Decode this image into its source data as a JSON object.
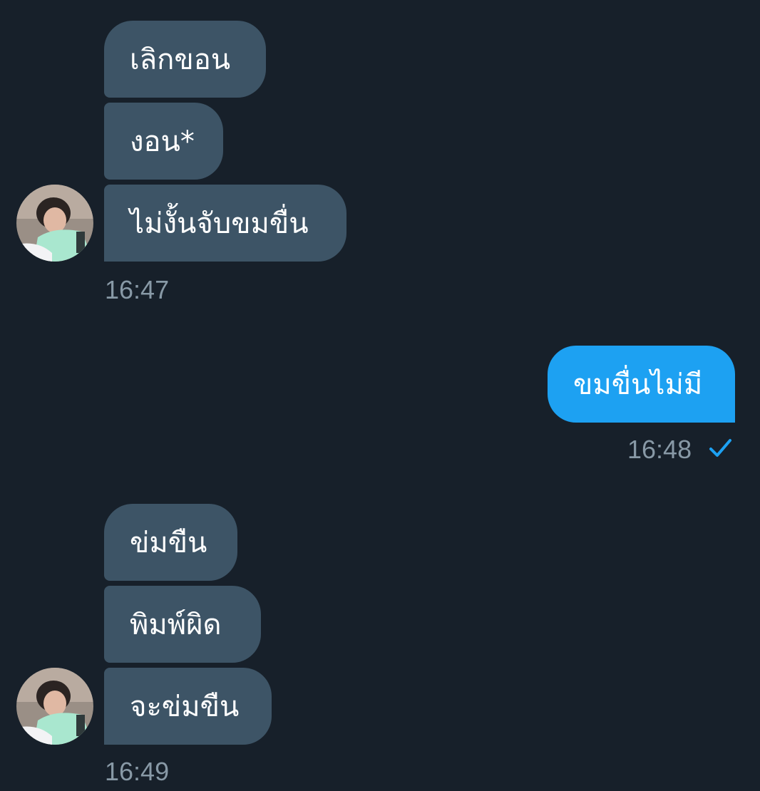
{
  "colors": {
    "background": "#17202a",
    "incoming_bubble": "#3d5466",
    "outgoing_bubble": "#1da1f2",
    "timestamp": "#8899a6",
    "check": "#1da1f2"
  },
  "messages": {
    "group1": {
      "bubbles": [
        "เลิกขอน",
        "งอน*",
        "ไม่งั้นจับขมขื่น"
      ],
      "time": "16:47",
      "avatar": "user-avatar"
    },
    "group2": {
      "bubbles": [
        "ขมขื่นไม่มี"
      ],
      "time": "16:48",
      "status_icon": "sent-check-icon"
    },
    "group3": {
      "bubbles": [
        "ข่มขืน",
        "พิมพ์ผิด",
        "จะข่มขืน"
      ],
      "time": "16:49",
      "avatar": "user-avatar"
    }
  }
}
